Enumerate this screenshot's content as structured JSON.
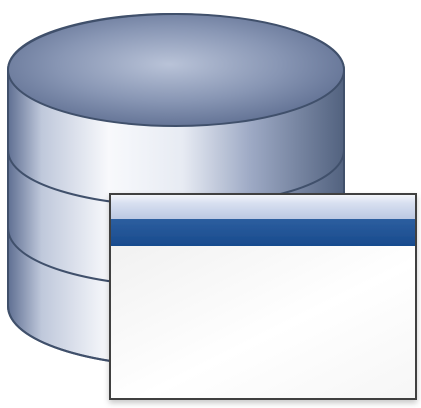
{
  "icon": {
    "name": "database-window-icon",
    "colors": {
      "background": "#ffffff",
      "cylinder_dark": "#5e6f8f",
      "cylinder_mid": "#cfd6e5",
      "cylinder_light": "#f8f9fc",
      "outline": "#3f4d69",
      "window_title_bar": "#1f4f92",
      "window_light": "#ffffff",
      "window_frame": "#3a3a3a"
    }
  }
}
